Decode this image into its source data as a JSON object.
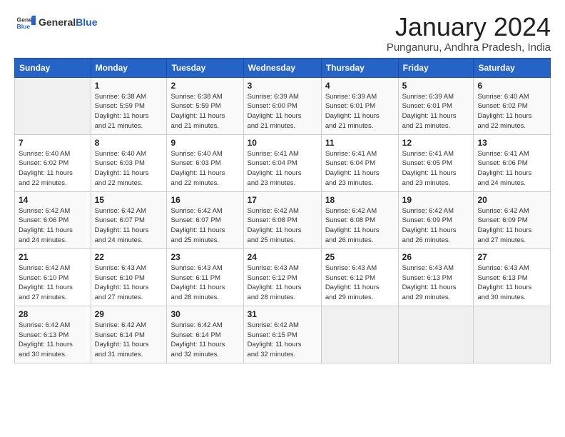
{
  "header": {
    "logo_general": "General",
    "logo_blue": "Blue",
    "month_year": "January 2024",
    "location": "Punganuru, Andhra Pradesh, India"
  },
  "days_of_week": [
    "Sunday",
    "Monday",
    "Tuesday",
    "Wednesday",
    "Thursday",
    "Friday",
    "Saturday"
  ],
  "weeks": [
    [
      {
        "day": "",
        "info": ""
      },
      {
        "day": "1",
        "info": "Sunrise: 6:38 AM\nSunset: 5:59 PM\nDaylight: 11 hours\nand 21 minutes."
      },
      {
        "day": "2",
        "info": "Sunrise: 6:38 AM\nSunset: 5:59 PM\nDaylight: 11 hours\nand 21 minutes."
      },
      {
        "day": "3",
        "info": "Sunrise: 6:39 AM\nSunset: 6:00 PM\nDaylight: 11 hours\nand 21 minutes."
      },
      {
        "day": "4",
        "info": "Sunrise: 6:39 AM\nSunset: 6:01 PM\nDaylight: 11 hours\nand 21 minutes."
      },
      {
        "day": "5",
        "info": "Sunrise: 6:39 AM\nSunset: 6:01 PM\nDaylight: 11 hours\nand 21 minutes."
      },
      {
        "day": "6",
        "info": "Sunrise: 6:40 AM\nSunset: 6:02 PM\nDaylight: 11 hours\nand 22 minutes."
      }
    ],
    [
      {
        "day": "7",
        "info": "Sunrise: 6:40 AM\nSunset: 6:02 PM\nDaylight: 11 hours\nand 22 minutes."
      },
      {
        "day": "8",
        "info": "Sunrise: 6:40 AM\nSunset: 6:03 PM\nDaylight: 11 hours\nand 22 minutes."
      },
      {
        "day": "9",
        "info": "Sunrise: 6:40 AM\nSunset: 6:03 PM\nDaylight: 11 hours\nand 22 minutes."
      },
      {
        "day": "10",
        "info": "Sunrise: 6:41 AM\nSunset: 6:04 PM\nDaylight: 11 hours\nand 23 minutes."
      },
      {
        "day": "11",
        "info": "Sunrise: 6:41 AM\nSunset: 6:04 PM\nDaylight: 11 hours\nand 23 minutes."
      },
      {
        "day": "12",
        "info": "Sunrise: 6:41 AM\nSunset: 6:05 PM\nDaylight: 11 hours\nand 23 minutes."
      },
      {
        "day": "13",
        "info": "Sunrise: 6:41 AM\nSunset: 6:06 PM\nDaylight: 11 hours\nand 24 minutes."
      }
    ],
    [
      {
        "day": "14",
        "info": "Sunrise: 6:42 AM\nSunset: 6:06 PM\nDaylight: 11 hours\nand 24 minutes."
      },
      {
        "day": "15",
        "info": "Sunrise: 6:42 AM\nSunset: 6:07 PM\nDaylight: 11 hours\nand 24 minutes."
      },
      {
        "day": "16",
        "info": "Sunrise: 6:42 AM\nSunset: 6:07 PM\nDaylight: 11 hours\nand 25 minutes."
      },
      {
        "day": "17",
        "info": "Sunrise: 6:42 AM\nSunset: 6:08 PM\nDaylight: 11 hours\nand 25 minutes."
      },
      {
        "day": "18",
        "info": "Sunrise: 6:42 AM\nSunset: 6:08 PM\nDaylight: 11 hours\nand 26 minutes."
      },
      {
        "day": "19",
        "info": "Sunrise: 6:42 AM\nSunset: 6:09 PM\nDaylight: 11 hours\nand 26 minutes."
      },
      {
        "day": "20",
        "info": "Sunrise: 6:42 AM\nSunset: 6:09 PM\nDaylight: 11 hours\nand 27 minutes."
      }
    ],
    [
      {
        "day": "21",
        "info": "Sunrise: 6:42 AM\nSunset: 6:10 PM\nDaylight: 11 hours\nand 27 minutes."
      },
      {
        "day": "22",
        "info": "Sunrise: 6:43 AM\nSunset: 6:10 PM\nDaylight: 11 hours\nand 27 minutes."
      },
      {
        "day": "23",
        "info": "Sunrise: 6:43 AM\nSunset: 6:11 PM\nDaylight: 11 hours\nand 28 minutes."
      },
      {
        "day": "24",
        "info": "Sunrise: 6:43 AM\nSunset: 6:12 PM\nDaylight: 11 hours\nand 28 minutes."
      },
      {
        "day": "25",
        "info": "Sunrise: 6:43 AM\nSunset: 6:12 PM\nDaylight: 11 hours\nand 29 minutes."
      },
      {
        "day": "26",
        "info": "Sunrise: 6:43 AM\nSunset: 6:13 PM\nDaylight: 11 hours\nand 29 minutes."
      },
      {
        "day": "27",
        "info": "Sunrise: 6:43 AM\nSunset: 6:13 PM\nDaylight: 11 hours\nand 30 minutes."
      }
    ],
    [
      {
        "day": "28",
        "info": "Sunrise: 6:42 AM\nSunset: 6:13 PM\nDaylight: 11 hours\nand 30 minutes."
      },
      {
        "day": "29",
        "info": "Sunrise: 6:42 AM\nSunset: 6:14 PM\nDaylight: 11 hours\nand 31 minutes."
      },
      {
        "day": "30",
        "info": "Sunrise: 6:42 AM\nSunset: 6:14 PM\nDaylight: 11 hours\nand 32 minutes."
      },
      {
        "day": "31",
        "info": "Sunrise: 6:42 AM\nSunset: 6:15 PM\nDaylight: 11 hours\nand 32 minutes."
      },
      {
        "day": "",
        "info": ""
      },
      {
        "day": "",
        "info": ""
      },
      {
        "day": "",
        "info": ""
      }
    ]
  ]
}
